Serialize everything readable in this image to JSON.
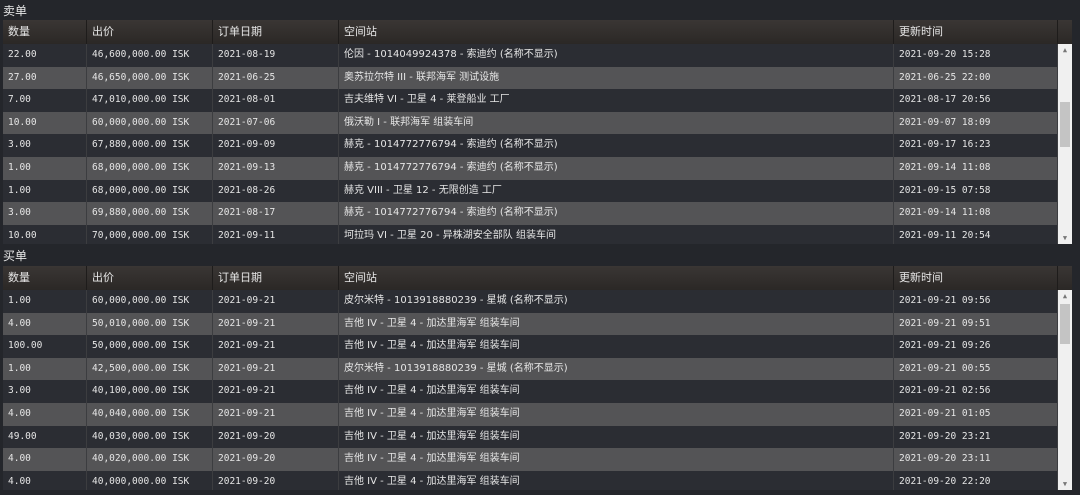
{
  "columns": [
    "数量",
    "出价",
    "订单日期",
    "空间站",
    "更新时间"
  ],
  "sell": {
    "title": "卖单",
    "scroll_fraction": 0.35,
    "rows": [
      [
        "22.00",
        "46,600,000.00 ISK",
        "2021-08-19",
        "伦因 - 1014049924378 - 索迪约 (名称不显示)",
        "2021-09-20 15:28"
      ],
      [
        "27.00",
        "46,650,000.00 ISK",
        "2021-06-25",
        "奥苏拉尔特 III - 联邦海军 测试设施",
        "2021-06-25 22:00"
      ],
      [
        "7.00",
        "47,010,000.00 ISK",
        "2021-08-01",
        "吉夫维特 VI - 卫星 4 - 莱登船业 工厂",
        "2021-08-17 20:56"
      ],
      [
        "10.00",
        "60,000,000.00 ISK",
        "2021-07-06",
        "俄沃勒 I - 联邦海军 组装车间",
        "2021-09-07 18:09"
      ],
      [
        "3.00",
        "67,880,000.00 ISK",
        "2021-09-09",
        "赫克 - 1014772776794 - 索迪约 (名称不显示)",
        "2021-09-17 16:23"
      ],
      [
        "1.00",
        "68,000,000.00 ISK",
        "2021-09-13",
        "赫克 - 1014772776794 - 索迪约 (名称不显示)",
        "2021-09-14 11:08"
      ],
      [
        "1.00",
        "68,000,000.00 ISK",
        "2021-08-26",
        "赫克 VIII - 卫星 12 - 无限创造 工厂",
        "2021-09-15 07:58"
      ],
      [
        "3.00",
        "69,880,000.00 ISK",
        "2021-08-17",
        "赫克 - 1014772776794 - 索迪约 (名称不显示)",
        "2021-09-14 11:08"
      ],
      [
        "10.00",
        "70,000,000.00 ISK",
        "2021-09-11",
        "坷拉玛 VI - 卫星 20 - 异株湖安全部队 组装车间",
        "2021-09-11 20:54"
      ]
    ]
  },
  "buy": {
    "title": "买单",
    "scroll_fraction": 0.0,
    "rows": [
      [
        "1.00",
        "60,000,000.00 ISK",
        "2021-09-21",
        "皮尔米特 - 1013918880239 - 星城 (名称不显示)",
        "2021-09-21 09:56"
      ],
      [
        "4.00",
        "50,010,000.00 ISK",
        "2021-09-21",
        "吉他 IV - 卫星 4 - 加达里海军 组装车间",
        "2021-09-21 09:51"
      ],
      [
        "100.00",
        "50,000,000.00 ISK",
        "2021-09-21",
        "吉他 IV - 卫星 4 - 加达里海军 组装车间",
        "2021-09-21 09:26"
      ],
      [
        "1.00",
        "42,500,000.00 ISK",
        "2021-09-21",
        "皮尔米特 - 1013918880239 - 星城 (名称不显示)",
        "2021-09-21 00:55"
      ],
      [
        "3.00",
        "40,100,000.00 ISK",
        "2021-09-21",
        "吉他 IV - 卫星 4 - 加达里海军 组装车间",
        "2021-09-21 02:56"
      ],
      [
        "4.00",
        "40,040,000.00 ISK",
        "2021-09-21",
        "吉他 IV - 卫星 4 - 加达里海军 组装车间",
        "2021-09-21 01:05"
      ],
      [
        "49.00",
        "40,030,000.00 ISK",
        "2021-09-20",
        "吉他 IV - 卫星 4 - 加达里海军 组装车间",
        "2021-09-20 23:21"
      ],
      [
        "4.00",
        "40,020,000.00 ISK",
        "2021-09-20",
        "吉他 IV - 卫星 4 - 加达里海军 组装车间",
        "2021-09-20 23:11"
      ],
      [
        "4.00",
        "40,000,000.00 ISK",
        "2021-09-20",
        "吉他 IV - 卫星 4 - 加达里海军 组装车间",
        "2021-09-20 22:20"
      ]
    ]
  }
}
